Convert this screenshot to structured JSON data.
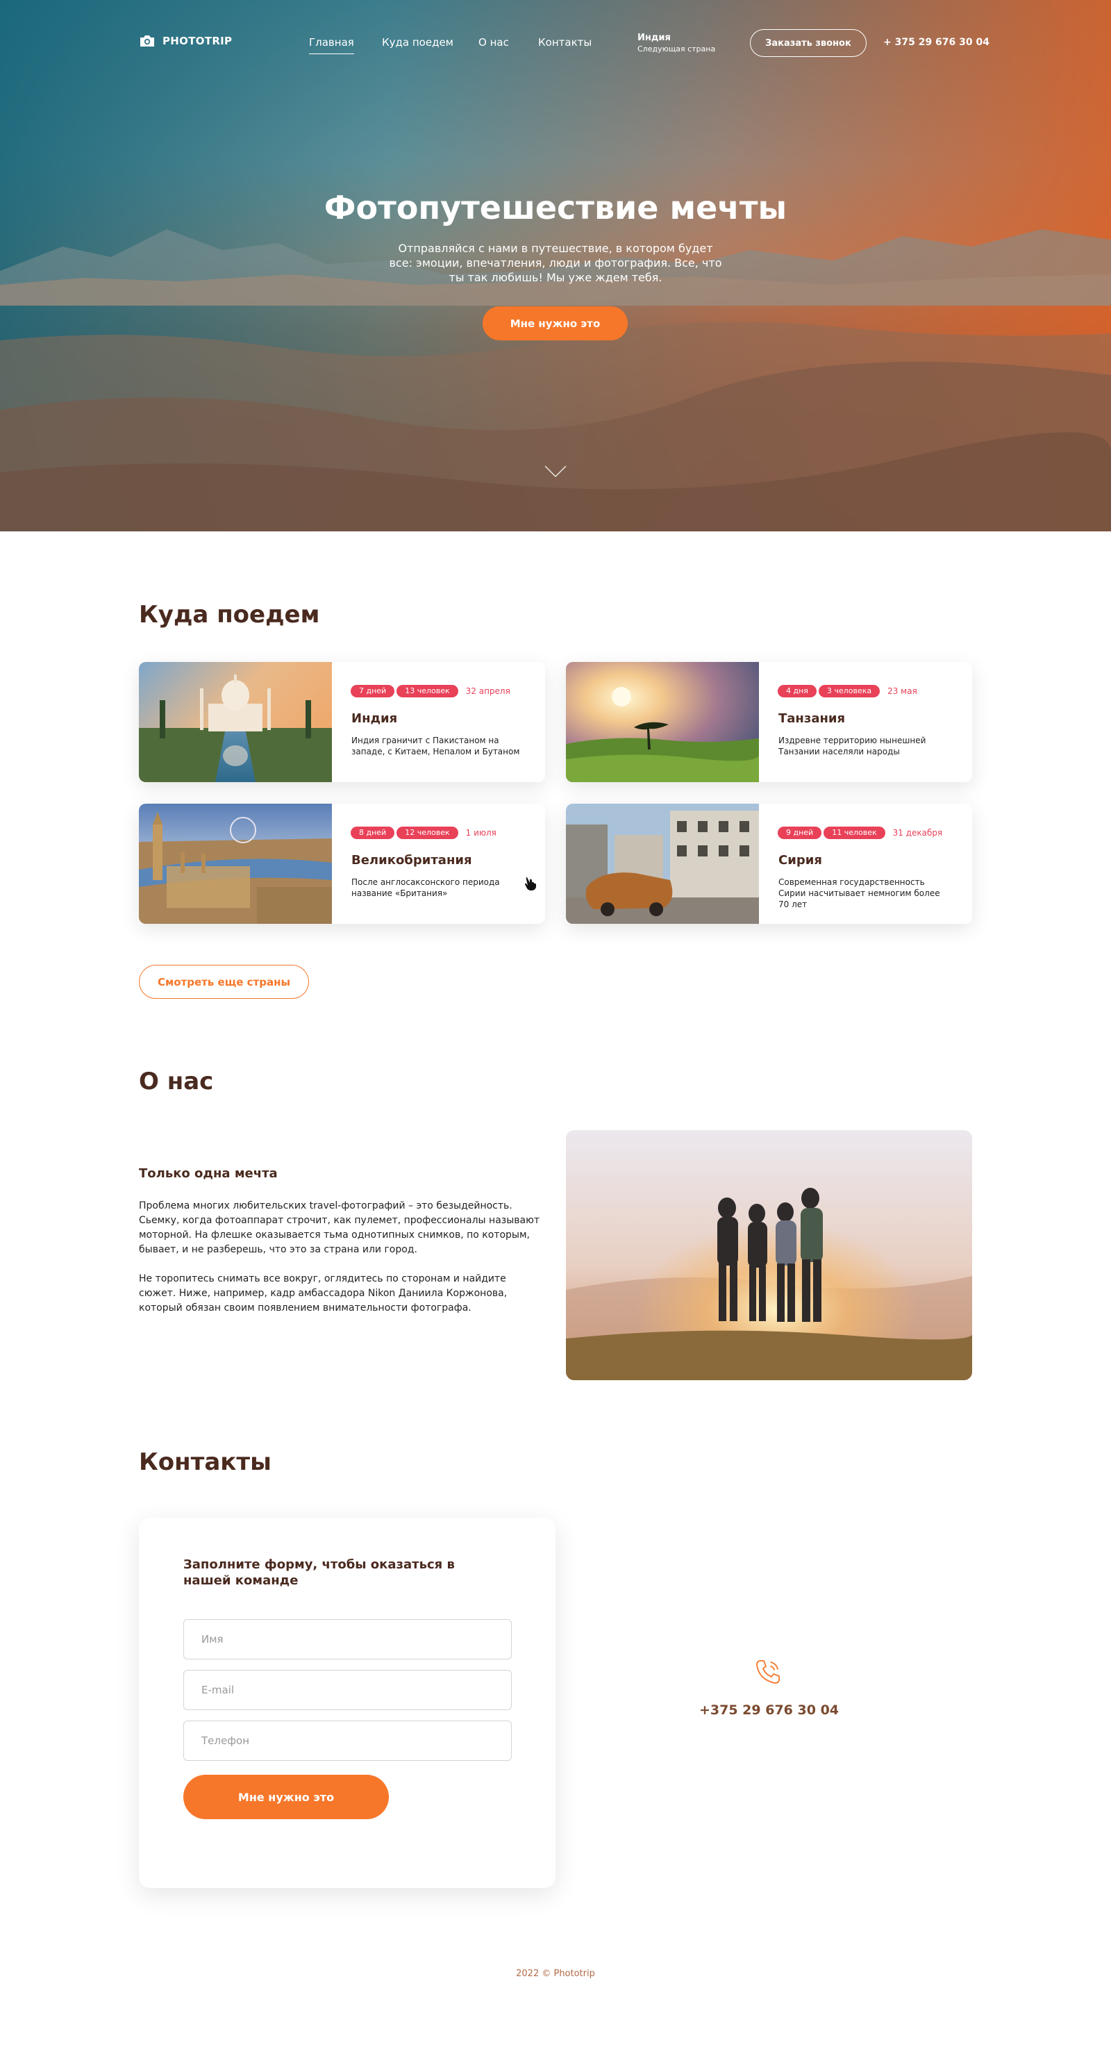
{
  "header": {
    "logo_text": "PHOTOTRIP",
    "nav": [
      "Главная",
      "Куда поедем",
      "О нас",
      "Контакты"
    ],
    "next_country_name": "Индия",
    "next_country_label": "Следующая страна",
    "callback_label": "Заказать звонок",
    "phone": "+ 375 29 676 30 04"
  },
  "hero": {
    "title": "Фотопутешествие мечты",
    "subtitle": "Отправляйся с нами в путешествие, в котором будет все: эмоции, впечатления, люди и фотография. Все, что ты так любишь! Мы уже ждем тебя.",
    "button_label": "Мне нужно это"
  },
  "destinations": {
    "title": "Куда поедем",
    "cards": [
      {
        "days": "7 дней",
        "people": "13 человек",
        "date": "32 апреля",
        "name": "Индия",
        "desc": "Индия граничит с Пакистаном на западе, с Китаем, Непалом и Бутаном"
      },
      {
        "days": "4 дня",
        "people": "3 человека",
        "date": "23 мая",
        "name": "Танзания",
        "desc": "Издревне территорию нынешней Танзании населяли народы"
      },
      {
        "days": "8 дней",
        "people": "12 человек",
        "date": "1 июля",
        "name": "Великобритания",
        "desc": "После англосаксонского периода название «Британия»"
      },
      {
        "days": "9 дней",
        "people": "11 человек",
        "date": "31 декабря",
        "name": "Сирия",
        "desc": "Современная государственность Сирии насчитывает немногим более 70 лет"
      }
    ],
    "more_button": "Смотреть еще страны"
  },
  "about": {
    "title": "О нас",
    "subtitle": "Только одна мечта",
    "paragraph1": "Проблема многих любительских travel-фотографий – это безыдейность. Сьемку, когда фотоаппарат строчит, как пулемет, профессионалы называют моторной. На флешке оказывается тьма однотипных снимков, по которым, бывает, и не разберешь, что это за страна или город.",
    "paragraph2": "Не торопитесь снимать все вокруг, оглядитесь по сторонам и найдите сюжет. Ниже, например, кадр амбассадора Nikon Даниила Коржонова, который обязан своим появлением внимательности фотографа."
  },
  "contacts": {
    "title": "Контакты",
    "form_title": "Заполните форму, чтобы оказаться в нашей команде",
    "name_placeholder": "Имя",
    "email_placeholder": "E-mail",
    "phone_placeholder": "Телефон",
    "submit_label": "Мне нужно это",
    "phone": "+375 29 676 30 04"
  },
  "footer": {
    "text": "2022 © Phototrip"
  },
  "colors": {
    "accent": "#f7772a",
    "tag": "#e84158",
    "heading": "#4a2a1f"
  }
}
